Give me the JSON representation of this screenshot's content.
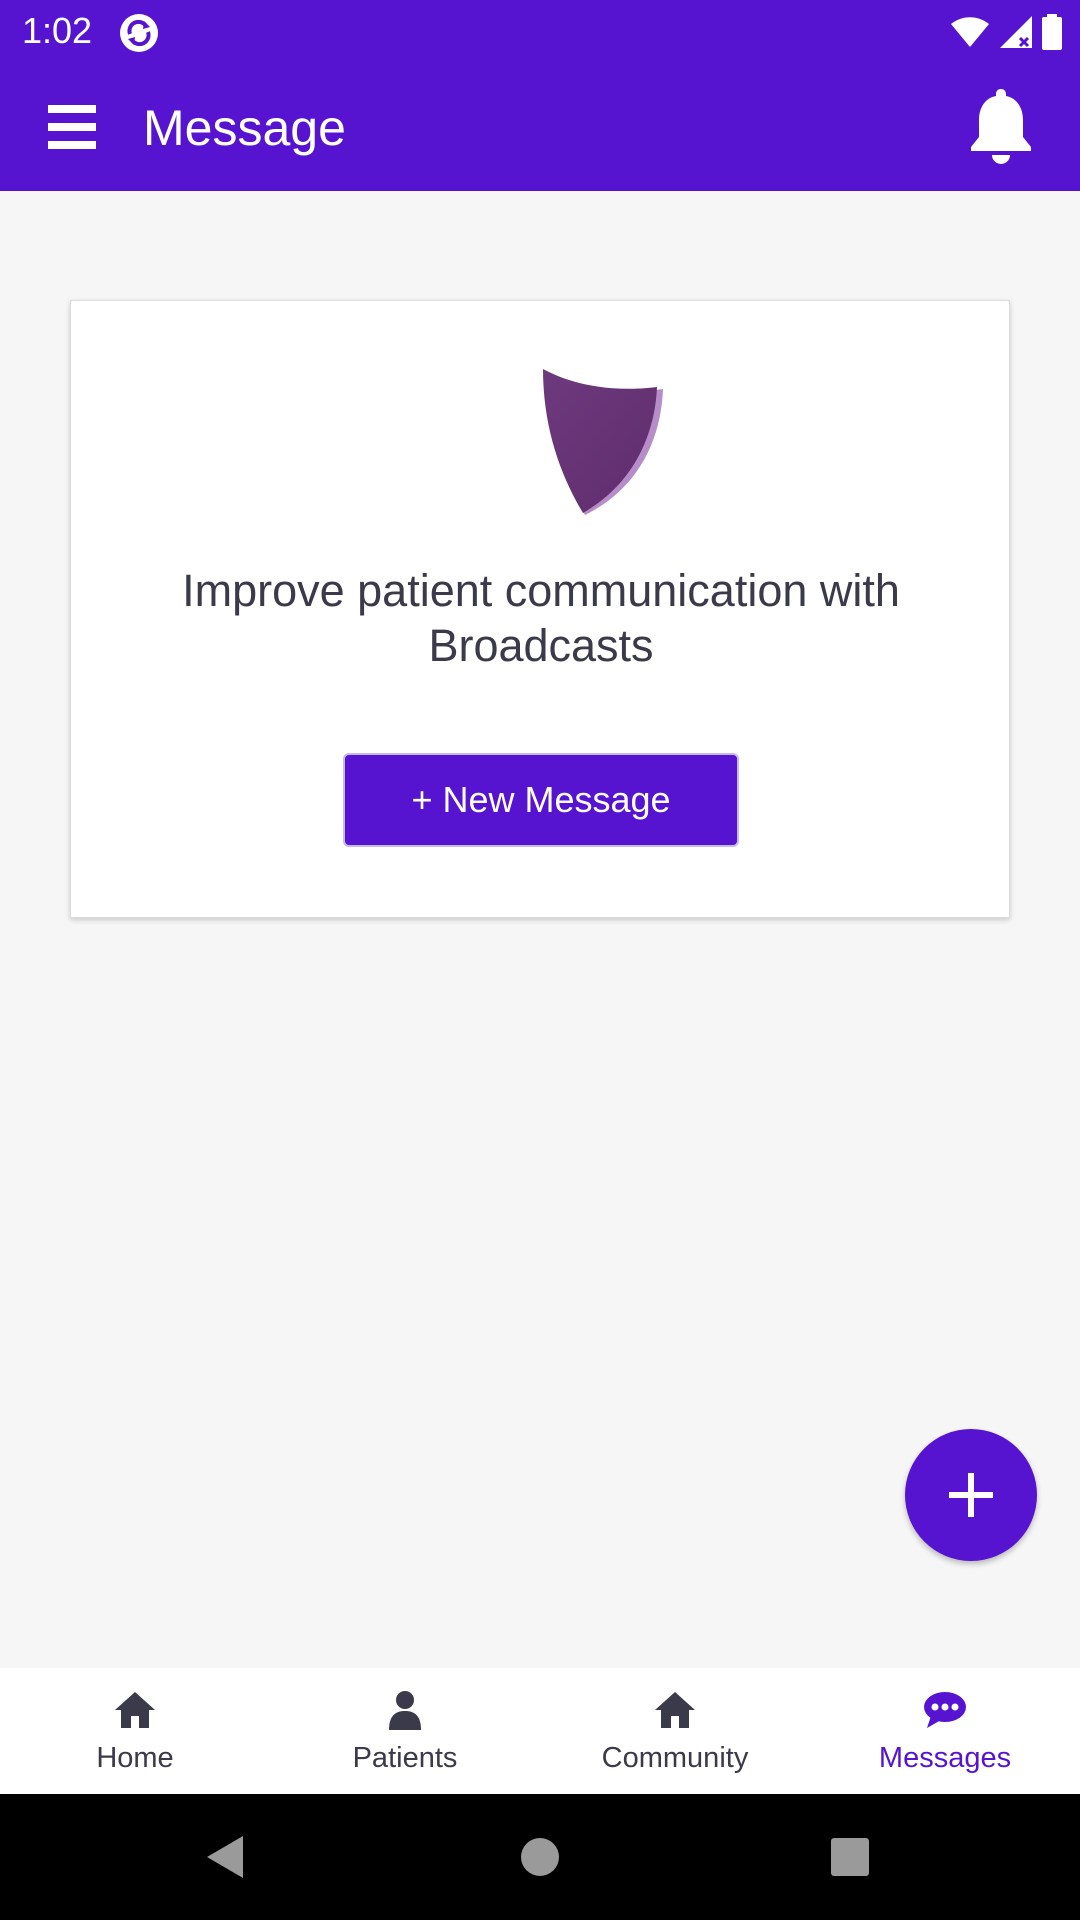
{
  "status_bar": {
    "time": "1:02",
    "icons": [
      "app-sync-icon",
      "wifi-icon",
      "signal-icon",
      "battery-icon"
    ]
  },
  "app_bar": {
    "title": "Message",
    "menu_icon": "hamburger-menu-icon",
    "notification_icon": "bell-icon"
  },
  "card": {
    "image": "shield-icon",
    "text": "Improve patient communication with Broadcasts",
    "button_label": "+ New Message"
  },
  "fab": {
    "icon": "plus-icon"
  },
  "bottom_nav": {
    "items": [
      {
        "label": "Home",
        "icon": "home-icon",
        "active": false
      },
      {
        "label": "Patients",
        "icon": "person-icon",
        "active": false
      },
      {
        "label": "Community",
        "icon": "home-icon",
        "active": false
      },
      {
        "label": "Messages",
        "icon": "chat-bubble-icon",
        "active": true
      }
    ]
  },
  "system_nav": {
    "buttons": [
      "back-icon",
      "home-circle-icon",
      "recents-square-icon"
    ]
  },
  "colors": {
    "primary": "#5714d0",
    "background": "#f6f6f6",
    "text": "#3a3a4a",
    "shield": "#6a3478"
  }
}
